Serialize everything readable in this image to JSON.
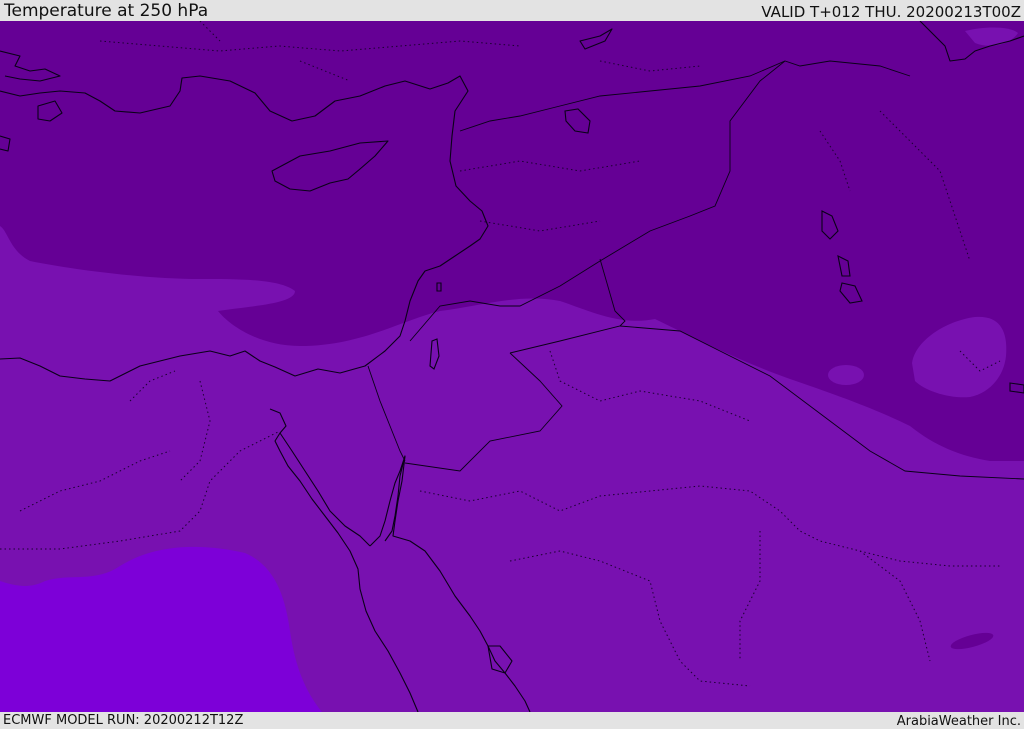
{
  "header": {
    "title": "Temperature at 250 hPa",
    "valid": "VALID T+012 THU. 20200213T00Z"
  },
  "footer": {
    "model_run": "ECMWF MODEL RUN: 20200212T12Z",
    "credit": "ArabiaWeather Inc."
  },
  "map": {
    "field": "Temperature at 250 hPa",
    "colors": {
      "coldest_band": "#650095",
      "middle_band": "#7811b0",
      "warmest_band": "#7d00d8",
      "coastline": "#0a0018"
    }
  }
}
